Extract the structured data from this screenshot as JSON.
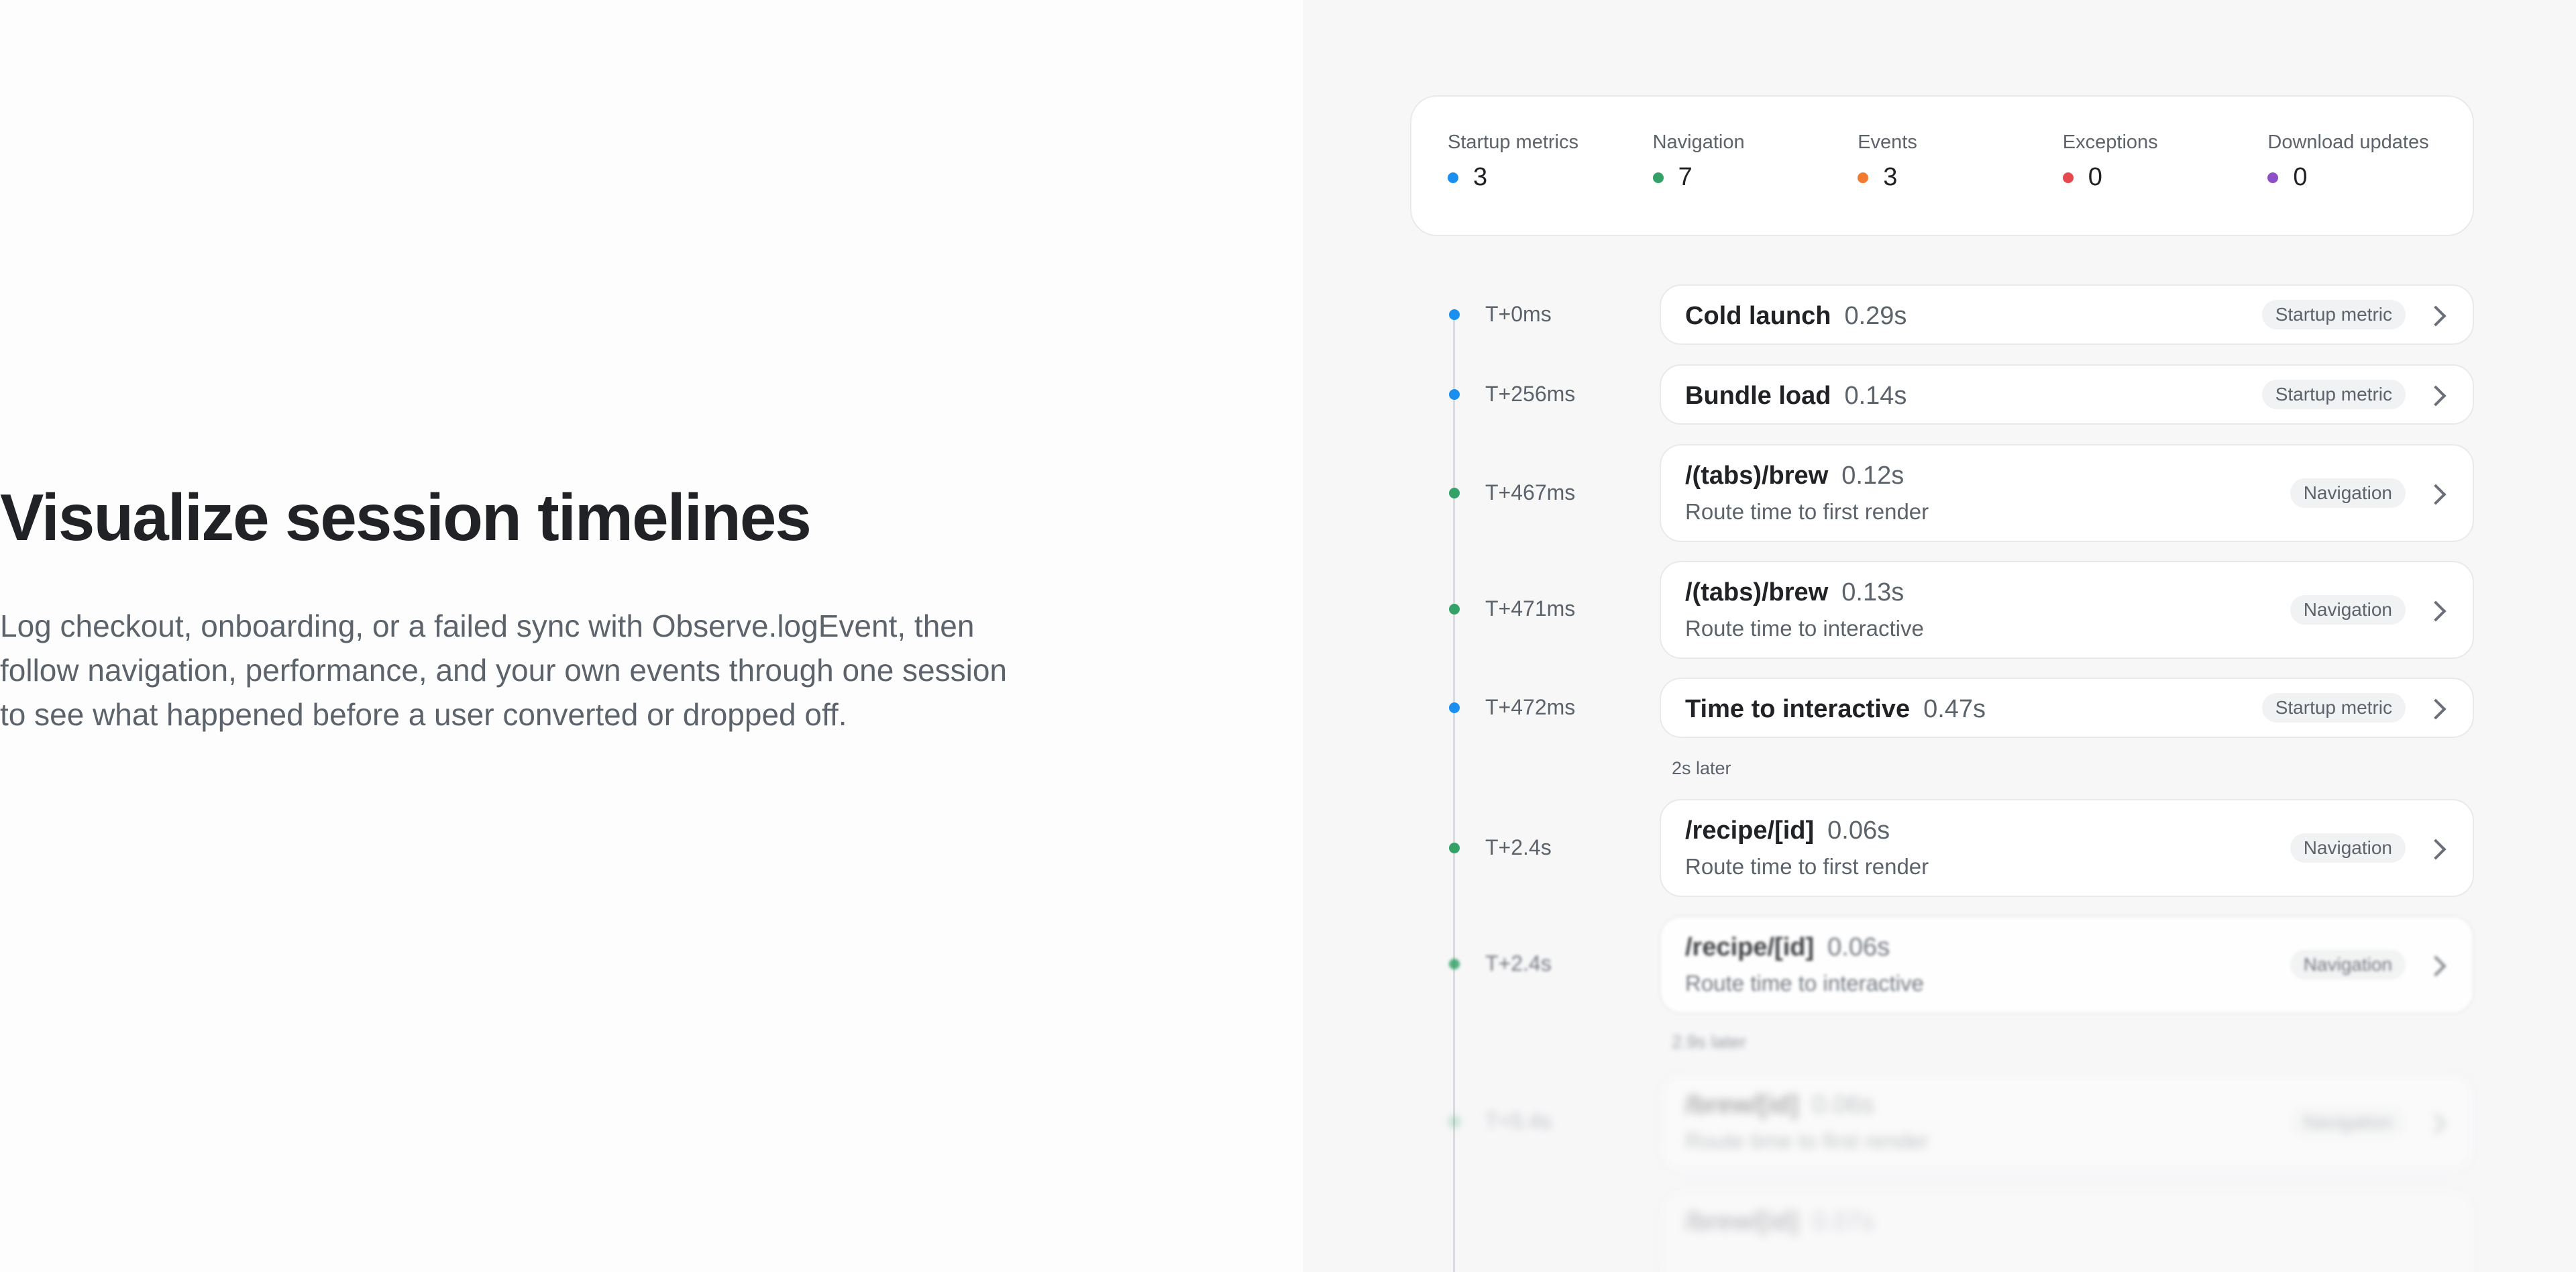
{
  "hero": {
    "title": "Visualize session timelines",
    "description": "Log checkout, onboarding, or a failed sync with Observe.logEvent, then follow navigation, performance, and your own events through one session to see what happened before a user converted or dropped off."
  },
  "summary": {
    "stats": [
      {
        "label": "Startup metrics",
        "value": "3",
        "color": "#1a8ff0"
      },
      {
        "label": "Navigation",
        "value": "7",
        "color": "#34a267"
      },
      {
        "label": "Events",
        "value": "3",
        "color": "#f17a2e"
      },
      {
        "label": "Exceptions",
        "value": "0",
        "color": "#e5484d"
      },
      {
        "label": "Download updates",
        "value": "0",
        "color": "#8e4ec6"
      }
    ]
  },
  "timeline": {
    "entries": [
      {
        "time": "T+0ms",
        "name": "Cold launch",
        "duration": "0.29s",
        "subtitle": "",
        "badge": "Startup metric",
        "color": "#1a8ff0"
      },
      {
        "time": "T+256ms",
        "name": "Bundle load",
        "duration": "0.14s",
        "subtitle": "",
        "badge": "Startup metric",
        "color": "#1a8ff0"
      },
      {
        "time": "T+467ms",
        "name": "/(tabs)/brew",
        "duration": "0.12s",
        "subtitle": "Route time to first render",
        "badge": "Navigation",
        "color": "#34a267"
      },
      {
        "time": "T+471ms",
        "name": "/(tabs)/brew",
        "duration": "0.13s",
        "subtitle": "Route time to interactive",
        "badge": "Navigation",
        "color": "#34a267"
      },
      {
        "time": "T+472ms",
        "name": "Time to interactive",
        "duration": "0.47s",
        "subtitle": "",
        "badge": "Startup metric",
        "color": "#1a8ff0"
      },
      {
        "time": "T+2.4s",
        "name": "/recipe/[id]",
        "duration": "0.06s",
        "subtitle": "Route time to first render",
        "badge": "Navigation",
        "color": "#34a267"
      },
      {
        "time": "T+2.4s",
        "name": "/recipe/[id]",
        "duration": "0.06s",
        "subtitle": "Route time to interactive",
        "badge": "Navigation",
        "color": "#34a267"
      },
      {
        "time": "T+5.4s",
        "name": "/brew/[id]",
        "duration": "0.06s",
        "subtitle": "Route time to first render",
        "badge": "Navigation",
        "color": "#34a267"
      },
      {
        "time": "",
        "name": "/brew/[id]",
        "duration": "0.07s",
        "subtitle": "",
        "badge": "",
        "color": "#34a267"
      }
    ],
    "gaps": [
      "2s later",
      "2.9s later"
    ]
  }
}
